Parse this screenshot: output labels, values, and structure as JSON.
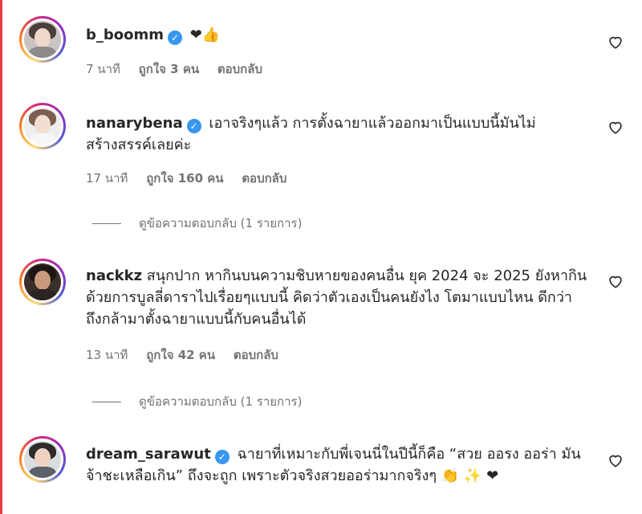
{
  "comments": [
    {
      "username": "b_boomm",
      "verified": true,
      "text": "",
      "emojis": "❤👍",
      "time": "7 นาที",
      "likes": "ถูกใจ 3 คน",
      "reply": "ตอบกลับ"
    },
    {
      "username": "nanarybena",
      "verified": true,
      "text": "เอาจริงๆแล้ว การตั้งฉายาแล้วออกมาเป็นแบบนี้มันไม่สร้างสรรค์เลยค่ะ",
      "time": "17 นาที",
      "likes": "ถูกใจ 160 คน",
      "reply": "ตอบกลับ",
      "view_replies": "ดูข้อความตอบกลับ (1 รายการ)"
    },
    {
      "username": "nackkz",
      "verified": false,
      "text": "สนุกปาก หากินบนความชิบหายของคนอื่น ยุค 2024 จะ 2025 ยังหากินด้วยการบูลลี่ดาราไปเรื่อยๆแบบนี้ คิดว่าตัวเองเป็นคนยังไง โตมาแบบไหน ดีกว่า ถึงกล้ามาตั้งฉายาแบบนี้กับคนอื่นได้",
      "time": "13 นาที",
      "likes": "ถูกใจ 42 คน",
      "reply": "ตอบกลับ",
      "view_replies": "ดูข้อความตอบกลับ (1 รายการ)"
    },
    {
      "username": "dream_sarawut",
      "verified": true,
      "text": "ฉายาที่เหมาะกับพี่เจนนี่ในปีนี้ก็คือ “สวย ออรง ออร่า มันจ้าชะเหลือเกิน” ถึงจะถูก เพราะตัวจริงสวยออร่ามากจริงๆ",
      "emojis": "👏 ✨ ❤"
    }
  ],
  "icons": {
    "verified": "verified-badge-icon",
    "like": "heart-outline-icon"
  },
  "colors": {
    "verified": "#3897f0",
    "meta": "#737373",
    "text": "#262626"
  }
}
